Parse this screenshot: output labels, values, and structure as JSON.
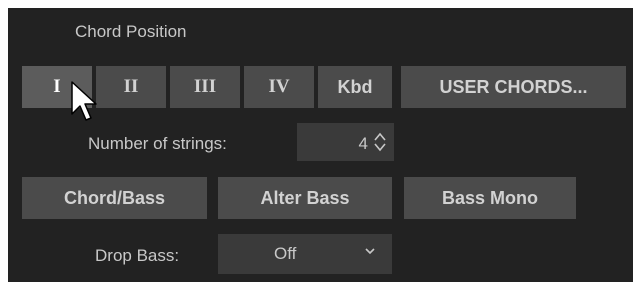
{
  "section": {
    "title": "Chord Position"
  },
  "position_buttons": [
    {
      "label": "I",
      "selected": true
    },
    {
      "label": "II",
      "selected": false
    },
    {
      "label": "III",
      "selected": false
    },
    {
      "label": "IV",
      "selected": false
    },
    {
      "label": "Kbd",
      "selected": false
    }
  ],
  "user_chords_button": "USER CHORDS...",
  "strings": {
    "label": "Number of strings:",
    "value": "4"
  },
  "mode_buttons": [
    "Chord/Bass",
    "Alter Bass",
    "Bass Mono"
  ],
  "drop_bass": {
    "label": "Drop Bass:",
    "value": "Off"
  },
  "icons": {
    "spinner": "up-down-spinner-icon",
    "dropdown": "chevron-down-icon",
    "pointer": "mouse-cursor-icon"
  },
  "colors": {
    "panel": "#222222",
    "button": "#4b4b4b",
    "button_text": "#d2d2d2",
    "label_text": "#c8c8c8"
  }
}
